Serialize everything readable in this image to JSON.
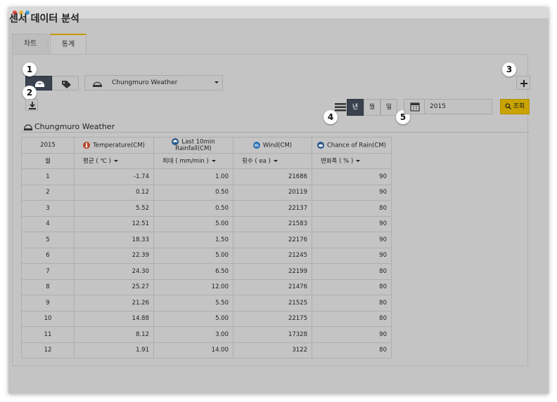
{
  "window": {
    "dots": [
      "#e0443e",
      "#e0b23e",
      "#3e9ee0"
    ]
  },
  "page_title": "센서 데이터 분석",
  "tabs": [
    {
      "label": "차트"
    },
    {
      "label": "통계"
    }
  ],
  "badges": [
    "1",
    "2",
    "3",
    "4",
    "5"
  ],
  "station_select": {
    "value": "Chungmuro Weather"
  },
  "period_segments": [
    "년",
    "월",
    "일"
  ],
  "date_field": {
    "value": "2015"
  },
  "query_button": {
    "label": "조회"
  },
  "section_title": "Chungmuro Weather",
  "table": {
    "year": "2015",
    "columns": [
      {
        "name": "Temperature(CM)",
        "unit_label": "평균 ( ℃ )",
        "icon": "thermometer-icon",
        "icon_color": "#b5462a"
      },
      {
        "name": "Last 10min Rainfall(CM)",
        "unit_label": "최대 ( mm/min )",
        "icon": "rain-icon",
        "icon_color": "#2a5a8c"
      },
      {
        "name": "Wind(CM)",
        "unit_label": "횟수 ( ea )",
        "icon": "wind-icon",
        "icon_color": "#2a6fb5"
      },
      {
        "name": "Chance of Rain(CM)",
        "unit_label": "변화폭 ( % )",
        "icon": "cloud-icon",
        "icon_color": "#2a5a8c"
      }
    ],
    "row_header_label": "월",
    "rows": [
      [
        "1",
        "-1.74",
        "1.00",
        "21686",
        "90"
      ],
      [
        "2",
        "0.12",
        "0.50",
        "20119",
        "90"
      ],
      [
        "3",
        "5.52",
        "0.50",
        "22137",
        "80"
      ],
      [
        "4",
        "12.51",
        "5.00",
        "21583",
        "90"
      ],
      [
        "5",
        "18.33",
        "1.50",
        "22176",
        "90"
      ],
      [
        "6",
        "22.39",
        "5.00",
        "21245",
        "90"
      ],
      [
        "7",
        "24.30",
        "6.50",
        "22199",
        "80"
      ],
      [
        "8",
        "25.27",
        "12.00",
        "21476",
        "80"
      ],
      [
        "9",
        "21.26",
        "5.50",
        "21525",
        "80"
      ],
      [
        "10",
        "14.88",
        "5.00",
        "22175",
        "80"
      ],
      [
        "11",
        "8.12",
        "3.00",
        "17328",
        "90"
      ],
      [
        "12",
        "1.91",
        "14.00",
        "3122",
        "80"
      ]
    ]
  },
  "colors": {
    "accent": "#c9a400",
    "dark_button": "#3a4250"
  }
}
